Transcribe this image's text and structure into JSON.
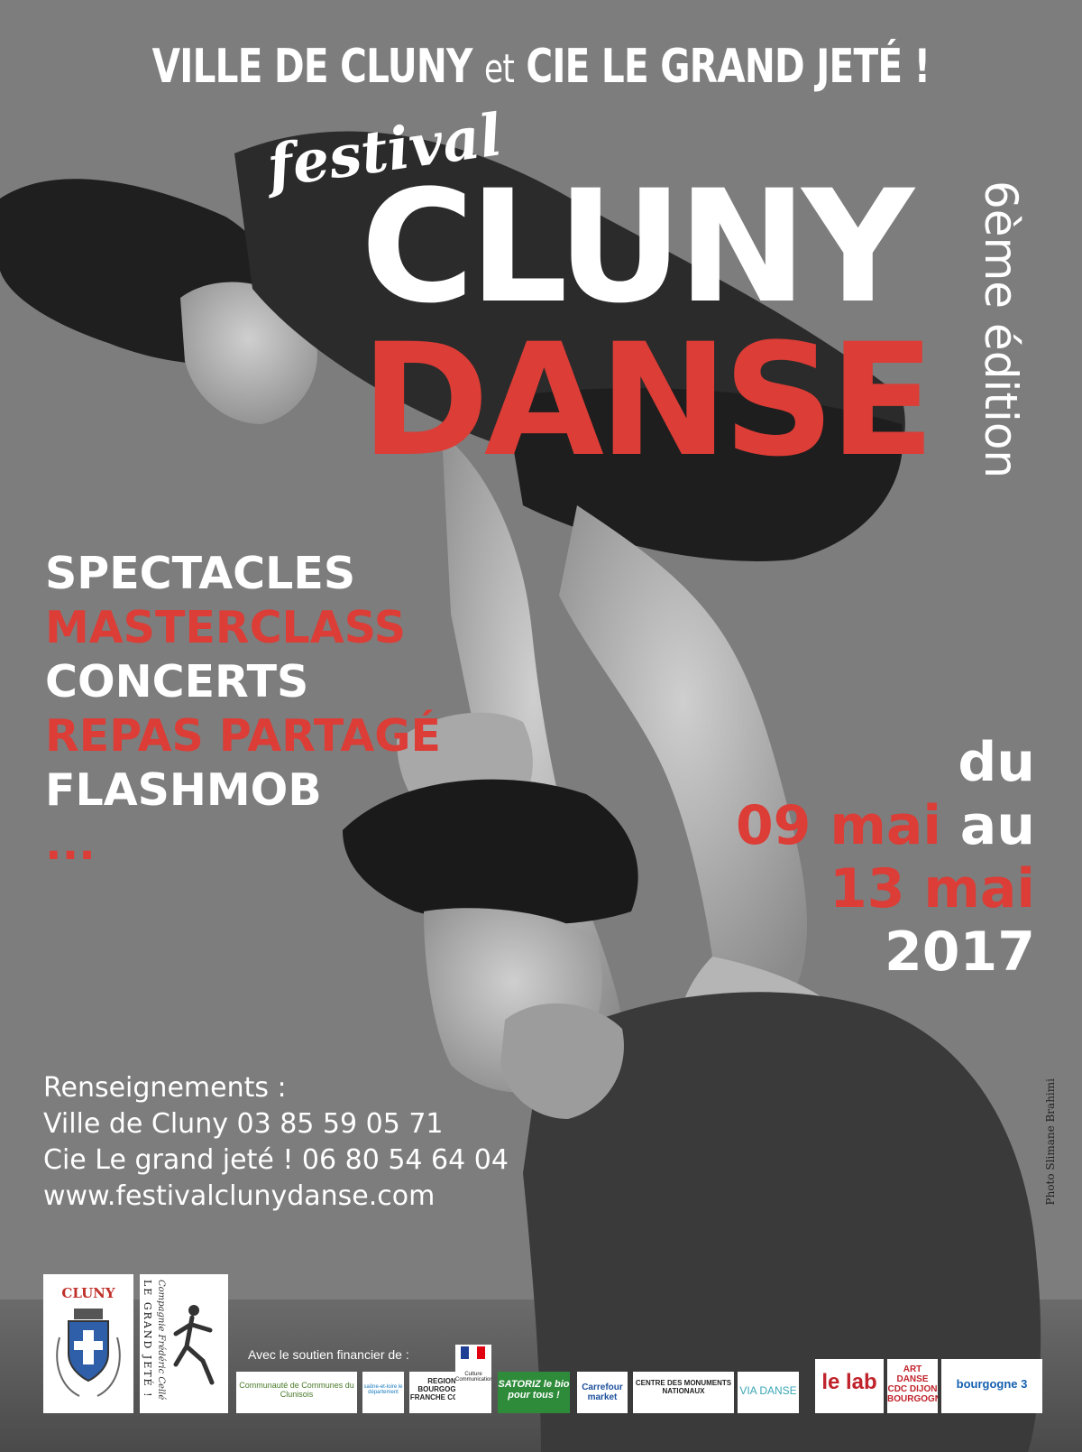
{
  "header": {
    "org1": "VILLE DE CLUNY",
    "conj": "et",
    "org2": "CIE LE GRAND JETÉ !"
  },
  "title": {
    "festival": "festival",
    "line1": "CLUNY",
    "line2": "DANSE",
    "edition": "6ème édition"
  },
  "activities": [
    {
      "label": "SPECTACLES",
      "color": "#ffffff"
    },
    {
      "label": "MASTERCLASS",
      "color": "#dc3d36"
    },
    {
      "label": "CONCERTS",
      "color": "#ffffff"
    },
    {
      "label": "REPAS PARTAGÉ",
      "color": "#dc3d36"
    },
    {
      "label": "FLASHMOB",
      "color": "#ffffff"
    },
    {
      "label": "...",
      "color": "#dc3d36"
    }
  ],
  "dates": {
    "du": "du",
    "start": "09 mai",
    "au": "au",
    "end": "13 mai",
    "year": "2017"
  },
  "info": {
    "heading": "Renseignements :",
    "line1": "Ville de Cluny 03 85 59 05 71",
    "line2": "Cie Le grand jeté ! 06 80 54 64 04",
    "website": "www.festivalclunydanse.com"
  },
  "photo_credit": "Photo Slimane Brahimi",
  "logos": {
    "cluny": "CLUNY",
    "grand_jete": "LE GRAND JETÉ !",
    "grand_jete_sub": "Compagnie Frédéric Cellé"
  },
  "sponsors": {
    "label": "Avec le soutien financier de :",
    "items": [
      {
        "name": "Communauté de Communes du Clunisois"
      },
      {
        "name": "saône-et-loire le département"
      },
      {
        "name": "REGION BOURGOGNE FRANCHE COMTE"
      },
      {
        "name": "Culture Communication"
      },
      {
        "name": "SATORIZ le bio pour tous !"
      },
      {
        "name": "Carrefour market"
      },
      {
        "name": "CENTRE DES MONUMENTS NATIONAUX"
      },
      {
        "name": "VIA DANSE"
      },
      {
        "name": "le lab"
      },
      {
        "name": "ART DANSE CDC DIJON BOURGOGNE"
      },
      {
        "name": "bourgogne 3"
      }
    ]
  },
  "colors": {
    "accent_red": "#dc3d36",
    "text_white": "#ffffff",
    "background_gray": "#7a7a7a"
  }
}
